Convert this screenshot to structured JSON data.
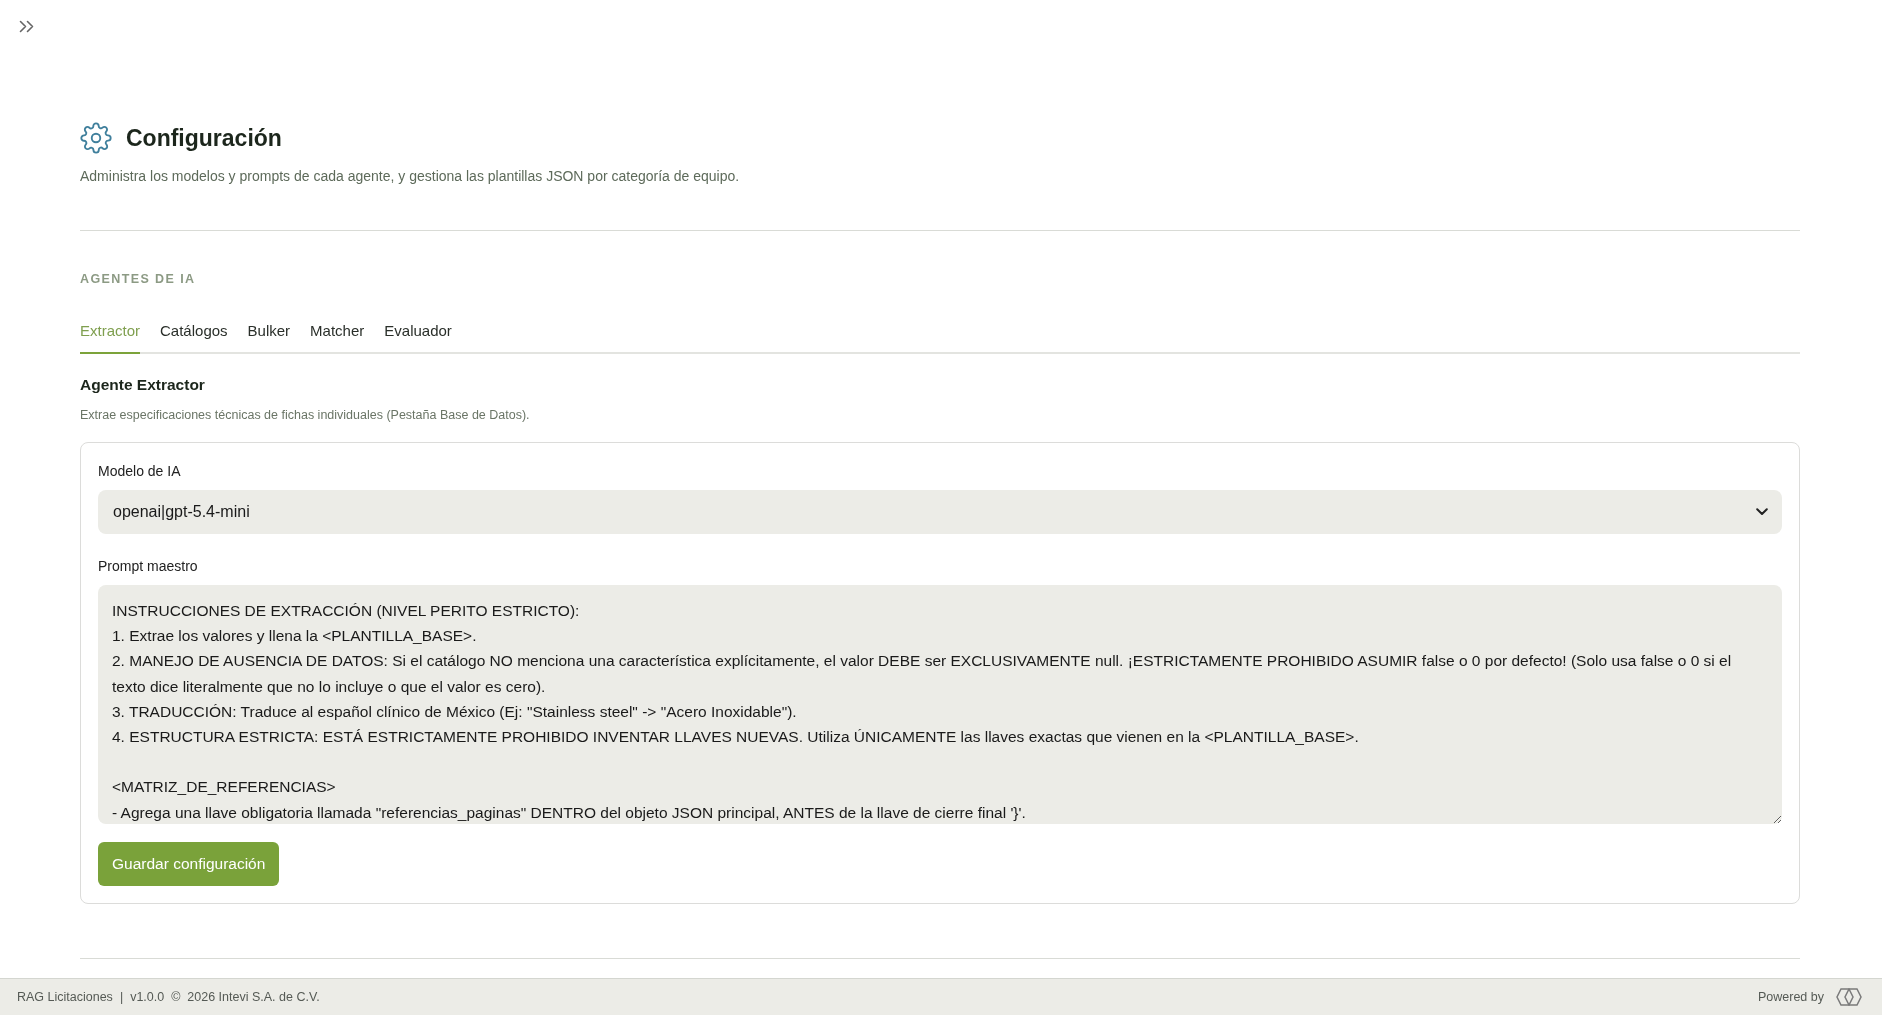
{
  "header": {
    "title": "Configuración",
    "subtitle": "Administra los modelos y prompts de cada agente, y gestiona las plantillas JSON por categoría de equipo."
  },
  "agents": {
    "heading": "AGENTES DE IA",
    "tabs": [
      {
        "label": "Extractor",
        "selected": true
      },
      {
        "label": "Catálogos",
        "selected": false
      },
      {
        "label": "Bulker",
        "selected": false
      },
      {
        "label": "Matcher",
        "selected": false
      },
      {
        "label": "Evaluador",
        "selected": false
      }
    ],
    "panel": {
      "title": "Agente Extractor",
      "description": "Extrae especificaciones técnicas de fichas individuales (Pestaña Base de Datos).",
      "model_label": "Modelo de IA",
      "model_value": "openai|gpt-5.4-mini",
      "prompt_label": "Prompt maestro",
      "prompt_value": "INSTRUCCIONES DE EXTRACCIÓN (NIVEL PERITO ESTRICTO):\n1. Extrae los valores y llena la <PLANTILLA_BASE>.\n2. MANEJO DE AUSENCIA DE DATOS: Si el catálogo NO menciona una característica explícitamente, el valor DEBE ser EXCLUSIVAMENTE null. ¡ESTRICTAMENTE PROHIBIDO ASUMIR false o 0 por defecto! (Solo usa false o 0 si el texto dice literalmente que no lo incluye o que el valor es cero).\n3. TRADUCCIÓN: Traduce al español clínico de México (Ej: \"Stainless steel\" -> \"Acero Inoxidable\").\n4. ESTRUCTURA ESTRICTA: ESTÁ ESTRICTAMENTE PROHIBIDO INVENTAR LLAVES NUEVAS. Utiliza ÚNICAMENTE las llaves exactas que vienen en la <PLANTILLA_BASE>.\n\n<MATRIZ_DE_REFERENCIAS>\n- Agrega una llave obligatoria llamada \"referencias_paginas\" DENTRO del objeto JSON principal, ANTES de la llave de cierre final '}'.",
      "save_button": "Guardar configuración"
    }
  },
  "footer": {
    "app_name": "RAG Licitaciones",
    "separator": "|",
    "version": "v1.0.0",
    "copyright": "©  2026 Intevi S.A. de C.V.",
    "powered_by": "Powered by"
  }
}
